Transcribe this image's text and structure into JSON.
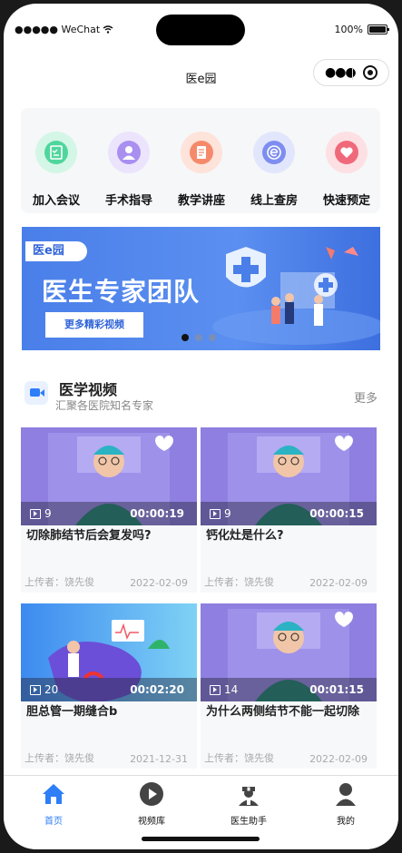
{
  "status": {
    "carrier": "●●●●● WeChat",
    "battery": "100%"
  },
  "nav": {
    "title": "医e园"
  },
  "quick_actions": [
    {
      "label": "加入会议",
      "icon": "checklist-icon",
      "color": "#4fd69c"
    },
    {
      "label": "手术指导",
      "icon": "doctor-icon",
      "color": "#a98ff0"
    },
    {
      "label": "教学讲座",
      "icon": "document-icon",
      "color": "#f58a6b"
    },
    {
      "label": "线上查房",
      "icon": "e-icon",
      "color": "#7d8df0"
    },
    {
      "label": "快速预定",
      "icon": "heart-icon",
      "color": "#f0697a"
    }
  ],
  "banner": {
    "tag": "医e园",
    "title": "医生专家团队",
    "button": "更多精彩视频",
    "slide_count": 3,
    "active_slide": 1
  },
  "section": {
    "title": "医学视频",
    "subtitle": "汇聚各医院知名专家",
    "more": "更多"
  },
  "videos": [
    {
      "count": "9",
      "duration": "00:00:19",
      "title": "切除肺结节后会复发吗?",
      "uploader": "上传者：饶先俊",
      "date": "2022-02-09"
    },
    {
      "count": "9",
      "duration": "00:00:15",
      "title": "钙化灶是什么?",
      "uploader": "上传者：饶先俊",
      "date": "2022-02-09"
    },
    {
      "count": "20",
      "duration": "00:02:20",
      "title": "胆总管一期缝合b",
      "uploader": "上传者：饶先俊",
      "date": "2021-12-31"
    },
    {
      "count": "14",
      "duration": "00:01:15",
      "title": "为什么两侧结节不能一起切除",
      "uploader": "上传者：饶先俊",
      "date": "2022-02-09"
    }
  ],
  "tabs": [
    {
      "label": "首页",
      "active": true
    },
    {
      "label": "视频库",
      "active": false
    },
    {
      "label": "医生助手",
      "active": false
    },
    {
      "label": "我的",
      "active": false
    }
  ],
  "colors": {
    "accent": "#2d7ef7",
    "banner": "#4a7fe9"
  }
}
